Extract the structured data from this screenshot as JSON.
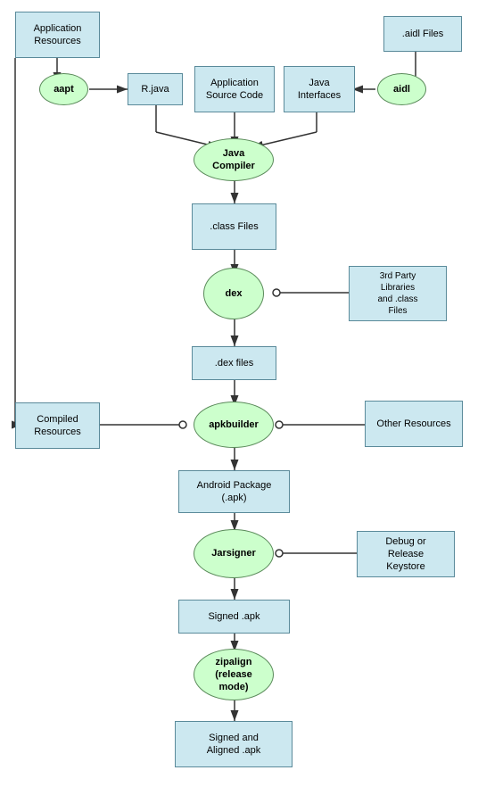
{
  "nodes": {
    "application_resources": {
      "label": "Application\nResources"
    },
    "aidl_files": {
      "label": ".aidl Files"
    },
    "aapt": {
      "label": "aapt"
    },
    "r_java": {
      "label": "R.java"
    },
    "application_source_code": {
      "label": "Application\nSource Code"
    },
    "java_interfaces": {
      "label": "Java\nInterfaces"
    },
    "aidl": {
      "label": "aidl"
    },
    "java_compiler": {
      "label": "Java\nCompiler"
    },
    "class_files": {
      "label": ".class Files"
    },
    "dex": {
      "label": "dex"
    },
    "third_party": {
      "label": "3rd Party\nLibraries\nand .class\nFiles"
    },
    "dex_files": {
      "label": ".dex files"
    },
    "compiled_resources": {
      "label": "Compiled\nResources"
    },
    "apkbuilder": {
      "label": "apkbuilder"
    },
    "other_resources": {
      "label": "Other Resources"
    },
    "android_package": {
      "label": "Android Package\n(.apk)"
    },
    "jarsigner": {
      "label": "Jarsigner"
    },
    "debug_release": {
      "label": "Debug or\nRelease\nKeystore"
    },
    "signed_apk": {
      "label": "Signed .apk"
    },
    "zipalign": {
      "label": "zipalign\n(release\nmode)"
    },
    "signed_aligned": {
      "label": "Signed and\nAligned .apk"
    }
  }
}
